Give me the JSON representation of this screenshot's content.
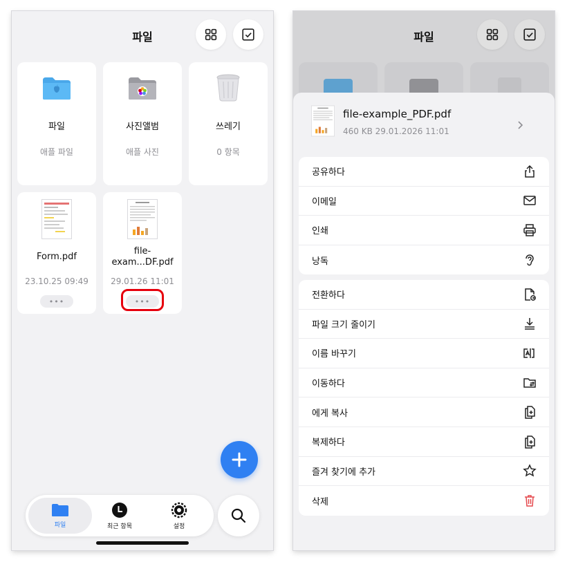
{
  "left": {
    "title": "파일",
    "cards": [
      {
        "name": "파일",
        "sub": "애플 파일",
        "icon": "folder-blue-apple-icon"
      },
      {
        "name": "사진앨범",
        "sub": "애플 사진",
        "icon": "photos-folder-icon"
      },
      {
        "name": "쓰레기",
        "sub": "0 항목",
        "icon": "trash-icon"
      },
      {
        "name": "Form.pdf",
        "sub": "23.10.25 09:49",
        "more": "•••"
      },
      {
        "name_line1": "file-",
        "name_line2": "exam...DF.pdf",
        "sub": "29.01.26 11:01",
        "more": "•••"
      }
    ],
    "tabs": [
      {
        "label": "파일",
        "icon": "folder-icon",
        "active": true
      },
      {
        "label": "최근 항목",
        "icon": "clock-icon"
      },
      {
        "label": "설정",
        "icon": "gear-icon"
      }
    ]
  },
  "right": {
    "title": "파일",
    "file": {
      "name": "file-example_PDF.pdf",
      "meta": "460 KB 29.01.2026 11:01"
    },
    "group1": [
      {
        "label": "공유하다",
        "icon": "share-icon"
      },
      {
        "label": "이메일",
        "icon": "mail-icon"
      },
      {
        "label": "인쇄",
        "icon": "printer-icon"
      },
      {
        "label": "낭독",
        "icon": "ear-icon"
      }
    ],
    "group2": [
      {
        "label": "전환하다",
        "icon": "convert-file-icon"
      },
      {
        "label": "파일 크기 줄이기",
        "icon": "compress-icon"
      },
      {
        "label": "이름 바꾸기",
        "icon": "rename-icon"
      },
      {
        "label": "이동하다",
        "icon": "move-folder-icon"
      },
      {
        "label": "에게 복사",
        "icon": "copy-to-icon"
      },
      {
        "label": "복제하다",
        "icon": "duplicate-icon"
      },
      {
        "label": "즐겨 찾기에 추가",
        "icon": "star-icon"
      },
      {
        "label": "삭제",
        "icon": "trash-icon"
      }
    ]
  },
  "colors": {
    "accent": "#2f80f2",
    "highlight": "#e6000d",
    "delete": "#e5484d"
  }
}
